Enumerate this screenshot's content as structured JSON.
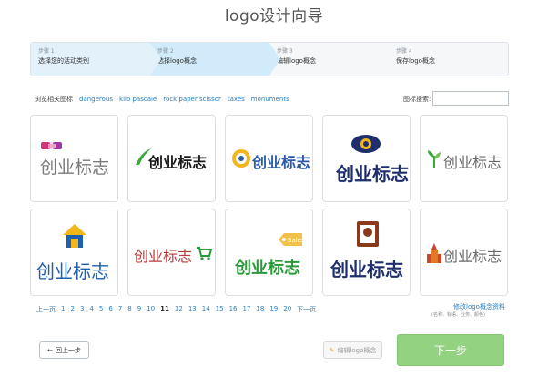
{
  "page": {
    "title": "logo设计向导"
  },
  "steps": [
    {
      "num": "步骤 1",
      "label": "选择您的活动类别"
    },
    {
      "num": "步骤 2",
      "label": "选择logo概念"
    },
    {
      "num": "步骤 3",
      "label": "编辑logo概念"
    },
    {
      "num": "步骤 4",
      "label": "保存logo概念"
    }
  ],
  "tags": {
    "prefix": "浏览相关图标",
    "items": [
      "dangerous",
      "kilo pascale",
      "rock paper scissor",
      "taxes",
      "monuments"
    ]
  },
  "search": {
    "label": "图标搜索:",
    "value": ""
  },
  "logos": [
    {
      "text": "创业标志",
      "color": "#7a7a7a",
      "icon": "hands-icon"
    },
    {
      "text": "创业标志",
      "color": "#1a1a1a",
      "icon": "swoosh-icon"
    },
    {
      "text": "创业标志",
      "color": "#2a5aa8",
      "icon": "target-icon"
    },
    {
      "text": "创业标志",
      "color": "#1f2f6e",
      "icon": "eye-icon"
    },
    {
      "text": "创业标志",
      "color": "#6a6a6a",
      "icon": "plant-icon"
    },
    {
      "text": "创业标志",
      "color": "#1e5fb0",
      "icon": "house-icon"
    },
    {
      "text": "创业标志",
      "color": "#b83a3a",
      "icon": "cart-icon"
    },
    {
      "text": "创业标志",
      "color": "#2a9a3a",
      "icon": "tag-icon"
    },
    {
      "text": "创业标志",
      "color": "#1f2f6e",
      "icon": "badge-icon"
    },
    {
      "text": "创业标志",
      "color": "#6a6a6a",
      "icon": "castle-icon"
    }
  ],
  "logo_tag_text": "Sales",
  "pager": {
    "prev": "上一页",
    "pages": [
      "1",
      "2",
      "3",
      "4",
      "5",
      "6",
      "7",
      "8",
      "9",
      "10",
      "11",
      "12",
      "13",
      "14",
      "15",
      "16",
      "17",
      "18",
      "19",
      "20"
    ],
    "current": "11",
    "next": "下一页"
  },
  "edit_link": {
    "label": "修改logo概念资料",
    "hint": "(名称、标语、业务、颜色)"
  },
  "buttons": {
    "back": "回上一步",
    "edit": "编辑logo概念",
    "next": "下一步"
  },
  "colors": {
    "accent": "#2a7fc1",
    "next_button": "#92d281",
    "step_active": "#d2ebfa"
  }
}
